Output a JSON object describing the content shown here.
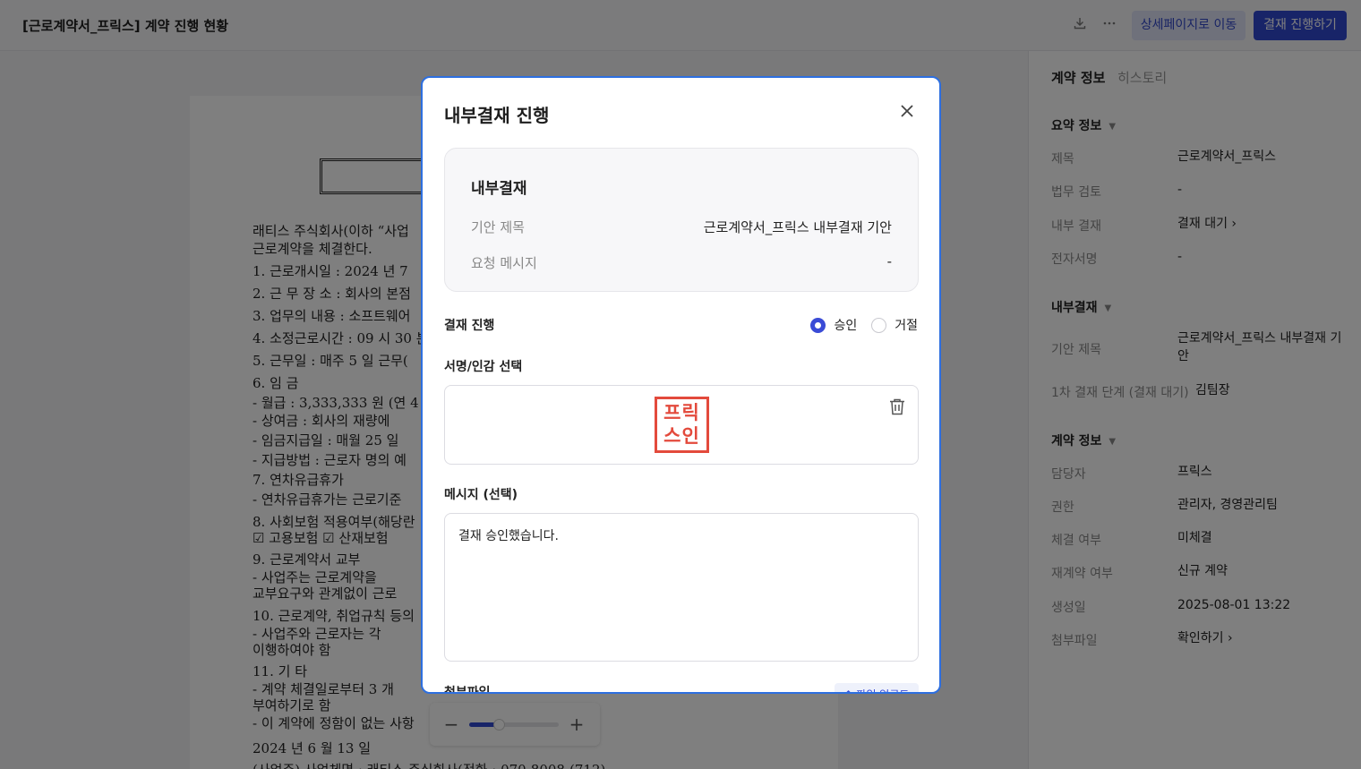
{
  "header": {
    "title": "[근로계약서_프릭스] 계약 진행 현황",
    "download_icon": "download-icon",
    "more_icon": "more-icon",
    "detail_button": "상세페이지로 이동",
    "proceed_button": "결재 진행하기"
  },
  "document": {
    "lines": [
      "래티스 주식회사(이하 “사업",
      "근로계약을 체결한다.",
      "1. 근로개시일 : 2024 년    7",
      "2. 근 무 장 소 : 회사의 본점",
      "3. 업무의 내용 : 소프트웨어",
      "4. 소정근로시간 : 09 시 30 분",
      "5. 근무일 : 매주 5 일 근무(",
      "6. 임   금",
      "   - 월급 : 3,333,333 원 (연 4",
      "   - 상여금 : 회사의 재량에",
      "   - 임금지급일 : 매월 25 일",
      "   - 지급방법 : 근로자 명의 예",
      "7. 연차유급휴가",
      "  - 연차유급휴가는 근로기준",
      "8. 사회보험 적용여부(해당란",
      "  ☑ 고용보험   ☑ 산재보험",
      "9. 근로계약서 교부",
      "    -  사업주는   근로계약을",
      "교부요구와 관계없이 근로",
      "10. 근로계약, 취업규칙 등의",
      "   - 사업주와  근로자는  각",
      "이행하여야 함",
      "11. 기   타",
      "- 계약   체결일로부터   3 개",
      "부여하기로 함",
      "- 이 계약에 정함이 없는 사항",
      "             2024 년        6 월         13 일",
      "(사업주) 사업체명 : 래티스 주식회사(전화 : 070-8008-(712)"
    ]
  },
  "zoom": {
    "minus": "−",
    "plus": "+",
    "level": 0.33
  },
  "sidebar": {
    "tabs": [
      "계약 정보",
      "히스토리"
    ],
    "summary": {
      "title": "요약 정보",
      "rows": [
        {
          "k": "제목",
          "v": "근로계약서_프릭스"
        },
        {
          "k": "법무 검토",
          "v": "-"
        },
        {
          "k": "내부 결재",
          "v": "결재 대기 ›"
        },
        {
          "k": "전자서명",
          "v": "-"
        }
      ]
    },
    "approval": {
      "title": "내부결재",
      "rows": [
        {
          "k": "기안 제목",
          "v": "근로계약서_프릭스 내부결재 기안"
        },
        {
          "k": "1차 결재 단계 (결재 대기)",
          "v": "김팀장"
        }
      ]
    },
    "contract": {
      "title": "계약 정보",
      "rows": [
        {
          "k": "담당자",
          "v": "프릭스"
        },
        {
          "k": "권한",
          "v": "관리자, 경영관리팀"
        },
        {
          "k": "체결 여부",
          "v": "미체결"
        },
        {
          "k": "재계약 여부",
          "v": "신규 계약"
        },
        {
          "k": "생성일",
          "v": "2025-08-01 13:22"
        },
        {
          "k": "첨부파일",
          "v": "확인하기 ›"
        }
      ]
    }
  },
  "modal": {
    "title": "내부결재 진행",
    "card": {
      "title": "내부결재",
      "draft_title_label": "기안 제목",
      "draft_title_value": "근로계약서_프릭스 내부결재 기안",
      "request_label": "요청 메시지",
      "request_value": "-"
    },
    "proceed_label": "결재 진행",
    "approve_label": "승인",
    "reject_label": "거절",
    "selected": "approve",
    "signature_label": "서명/인감 선택",
    "seal_text": "프릭스인",
    "message_label": "메시지 (선택)",
    "message_value": "결재 승인했습니다.",
    "attach_label": "첨부파일",
    "upload_button": "↑ 파일 업로드"
  },
  "colors": {
    "accent": "#3148d0",
    "seal": "#e34a3c",
    "modal_border": "#2d6fe0"
  }
}
